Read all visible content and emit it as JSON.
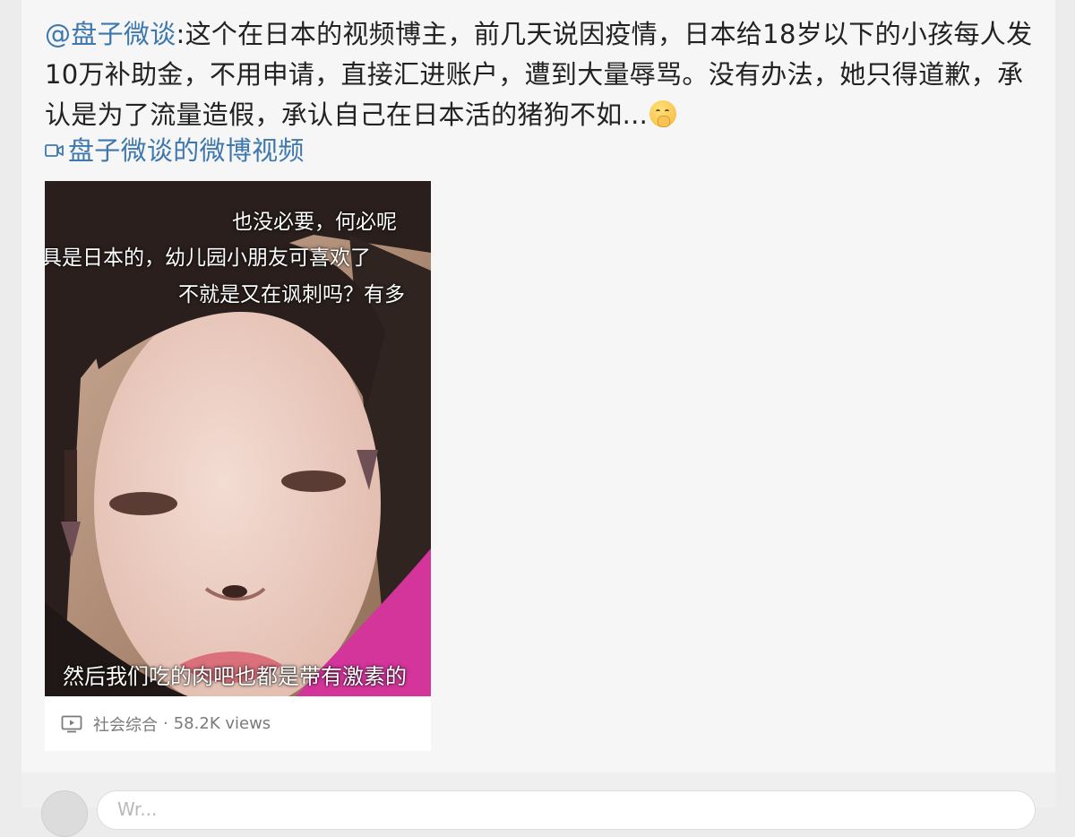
{
  "post": {
    "mention": "@盘子微谈",
    "text": ":这个在日本的视频博主，前几天说因疫情，日本给18岁以下的小孩每人发10万补助金，不用申请，直接汇进账户，遭到大量辱骂。没有办法，她只得道歉，承认是为了流量造假，承认自己在日本活的猪狗不如...",
    "emoji": "shushing-face-emoji",
    "video_link_icon": "video-camera-icon",
    "video_link": "盘子微谈的微博视频"
  },
  "video": {
    "subtitles": [
      "也没必要，何必呢",
      "具是日本的，幼儿园小朋友可喜欢了",
      "不就是又在讽刺吗？有多",
      "然后我们吃的肉吧也都是带有激素的"
    ],
    "footer_icon": "tv-icon",
    "category": "社会综合",
    "separator": "·",
    "views": "58.2K views"
  },
  "comment": {
    "avatar_icon": "avatar",
    "placeholder": "Wr..."
  }
}
